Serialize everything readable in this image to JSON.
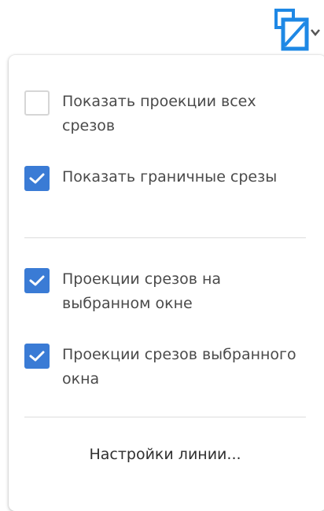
{
  "toolbar": {
    "button_icon": "slice-projection-icon",
    "accent_color": "#1e88e5"
  },
  "menu": {
    "items": [
      {
        "label": "Показать проекции всех срезов",
        "checked": false
      },
      {
        "label": "Показать граничные срезы",
        "checked": true
      },
      {
        "label": "Проекции срезов на выбранном окне",
        "checked": true
      },
      {
        "label": "Проекции срезов выбранного окна",
        "checked": true
      }
    ],
    "line_settings_label": "Настройки линии..."
  },
  "colors": {
    "checkbox_checked": "#3a7bd5",
    "checkbox_border": "#d6d6d6",
    "text": "#4a4a4a"
  }
}
